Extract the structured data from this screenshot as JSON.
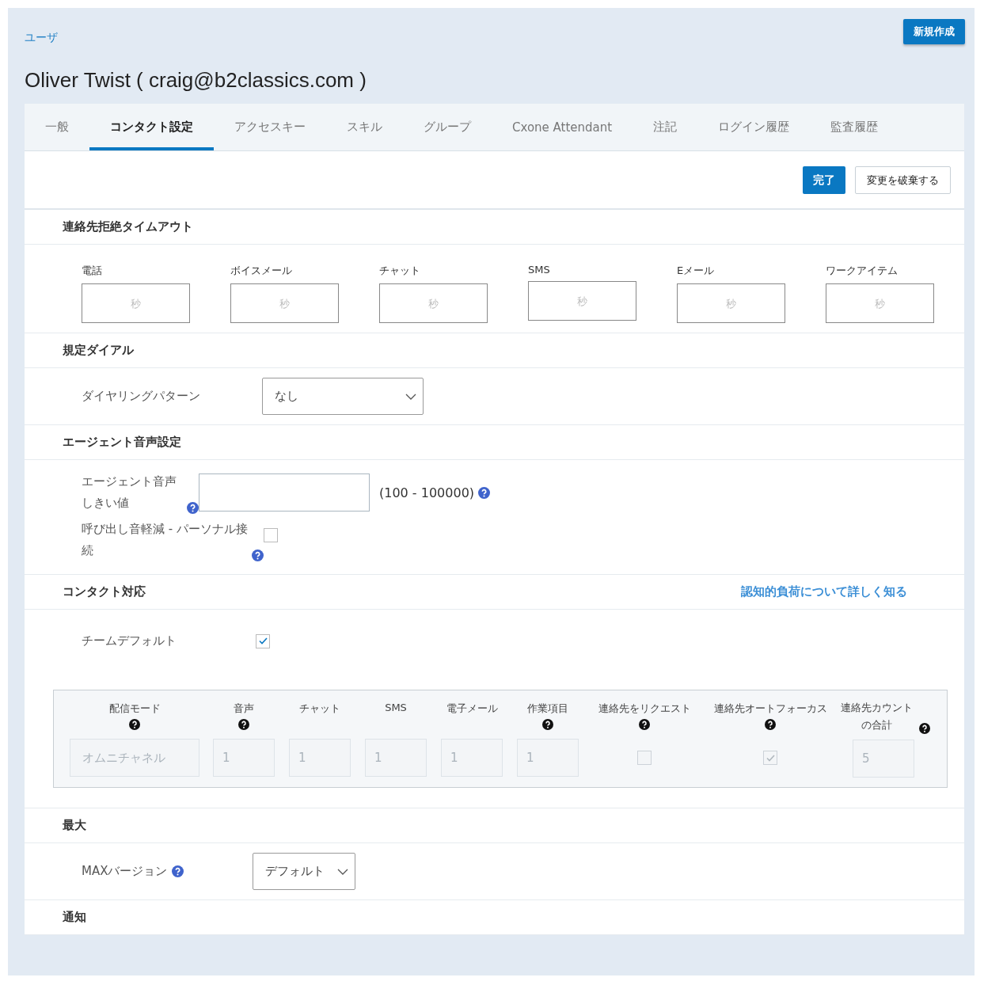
{
  "breadcrumb": "ユーザ",
  "new_button": "新規作成",
  "title": "Oliver Twist ( craig@b2classics.com )",
  "tabs": [
    {
      "label": "一般",
      "selected": false
    },
    {
      "label": "コンタクト設定",
      "selected": true
    },
    {
      "label": "アクセスキー",
      "selected": false
    },
    {
      "label": "スキル",
      "selected": false
    },
    {
      "label": "グループ",
      "selected": false
    },
    {
      "label": "Cxone Attendant",
      "selected": false
    },
    {
      "label": "注記",
      "selected": false
    },
    {
      "label": "ログイン履歴",
      "selected": false
    },
    {
      "label": "監査履歴",
      "selected": false
    }
  ],
  "actions": {
    "done": "完了",
    "discard": "変更を破棄する"
  },
  "sections": [
    {
      "kind": "timeouts",
      "heading": "連絡先拒絶タイムアウト",
      "fields": [
        {
          "label": "電話",
          "placeholder": "秒"
        },
        {
          "label": "ボイスメール",
          "placeholder": "秒"
        },
        {
          "label": "チャット",
          "placeholder": "秒"
        },
        {
          "label": "SMS",
          "placeholder": "秒"
        },
        {
          "label": "Eメール",
          "placeholder": "秒"
        },
        {
          "label": "ワークアイテム",
          "placeholder": "秒"
        }
      ]
    },
    {
      "kind": "select",
      "heading": "規定ダイアル",
      "label": "ダイヤリングパターン",
      "value": "なし",
      "help": false
    },
    {
      "kind": "voice",
      "heading": "エージェント音声設定",
      "threshold_label": "エージェント音声しきい値",
      "range": "(100 - 100000)",
      "reduction_label": "呼び出し音軽減 - パーソナル接続",
      "reduction_checked": false
    },
    {
      "kind": "contact",
      "heading": "コンタクト対応",
      "link": "認知的負荷について詳しく知る",
      "team_default_label": "チームデフォルト",
      "team_default_checked": true,
      "disabled": true,
      "columns": [
        {
          "label": "配信モード",
          "help": true,
          "kind": "select",
          "value": "オムニチャネル"
        },
        {
          "label": "音声",
          "help": true,
          "kind": "number",
          "value": "1"
        },
        {
          "label": "チャット",
          "help": false,
          "kind": "number",
          "value": "1"
        },
        {
          "label": "SMS",
          "help": false,
          "kind": "number",
          "value": "1"
        },
        {
          "label": "電子メール",
          "help": false,
          "kind": "number",
          "value": "1"
        },
        {
          "label": "作業項目",
          "help": true,
          "kind": "number",
          "value": "1"
        },
        {
          "label": "連絡先をリクエスト",
          "help": true,
          "kind": "checkbox",
          "checked": false
        },
        {
          "label": "連絡先オートフォーカス",
          "help": true,
          "kind": "checkbox",
          "checked": true
        },
        {
          "label": "連絡先カウントの合計",
          "help": true,
          "kind": "number",
          "value": "5"
        }
      ]
    },
    {
      "kind": "select",
      "heading": "最大",
      "label": "MAXバージョン",
      "value": "デフォルト",
      "help": true
    },
    {
      "kind": "heading",
      "heading": "通知"
    }
  ]
}
